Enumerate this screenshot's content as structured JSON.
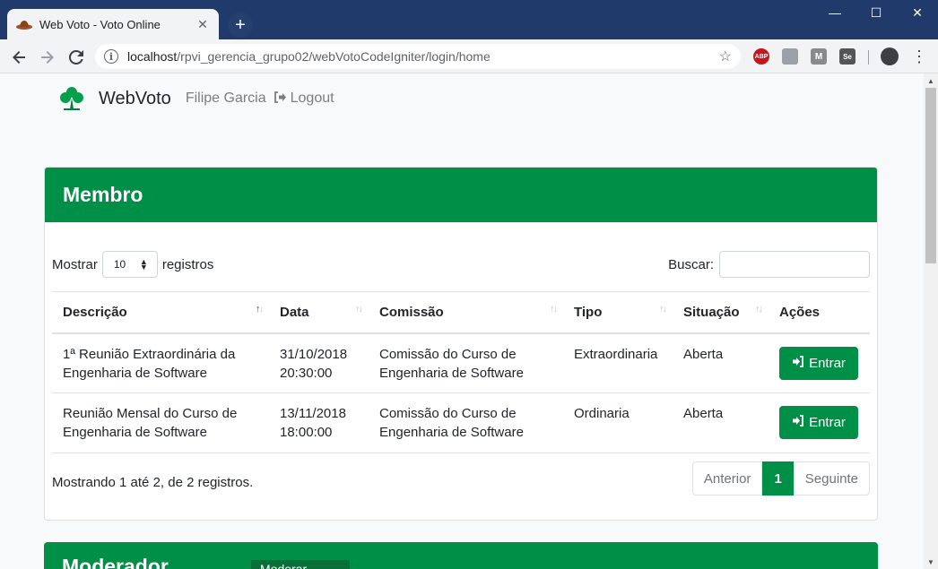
{
  "browser": {
    "tab_title": "Web Voto - Voto Online",
    "tab_close": "✕",
    "new_tab": "+",
    "window_min": "—",
    "window_max": "☐",
    "window_close": "✕",
    "url_host": "localhost",
    "url_path": "/rpvi_gerencia_grupo02/webVotoCodeIgniter/login/home",
    "extensions": [
      "ABP",
      "",
      "M",
      "Se"
    ]
  },
  "navbar": {
    "brand": "WebVoto",
    "user": "Filipe Garcia",
    "logout": "Logout"
  },
  "membro": {
    "title": "Membro",
    "length_label_before": "Mostrar",
    "length_value": "10",
    "length_label_after": "registros",
    "search_label": "Buscar:",
    "search_value": "",
    "columns": [
      "Descrição",
      "Data",
      "Comissão",
      "Tipo",
      "Situação",
      "Ações"
    ],
    "rows": [
      {
        "descricao": "1ª Reunião Extraordinária da Engenharia de Software",
        "data": "31/10/2018 20:30:00",
        "comissao": "Comissão do Curso de Engenharia de Software",
        "tipo": "Extraordinaria",
        "situacao": "Aberta",
        "acao": "Entrar"
      },
      {
        "descricao": "Reunião Mensal do Curso de Engenharia de Software",
        "data": "13/11/2018 18:00:00",
        "comissao": "Comissão do Curso de Engenharia de Software",
        "tipo": "Ordinaria",
        "situacao": "Aberta",
        "acao": "Entrar"
      }
    ],
    "info": "Mostrando 1 até 2, de 2 registros.",
    "pagination": {
      "prev": "Anterior",
      "current": "1",
      "next": "Seguinte"
    }
  },
  "moderador": {
    "title": "Moderador",
    "button": "Moderar"
  },
  "colors": {
    "primary_green": "#008f46",
    "tabbar": "#1f3a6b"
  }
}
